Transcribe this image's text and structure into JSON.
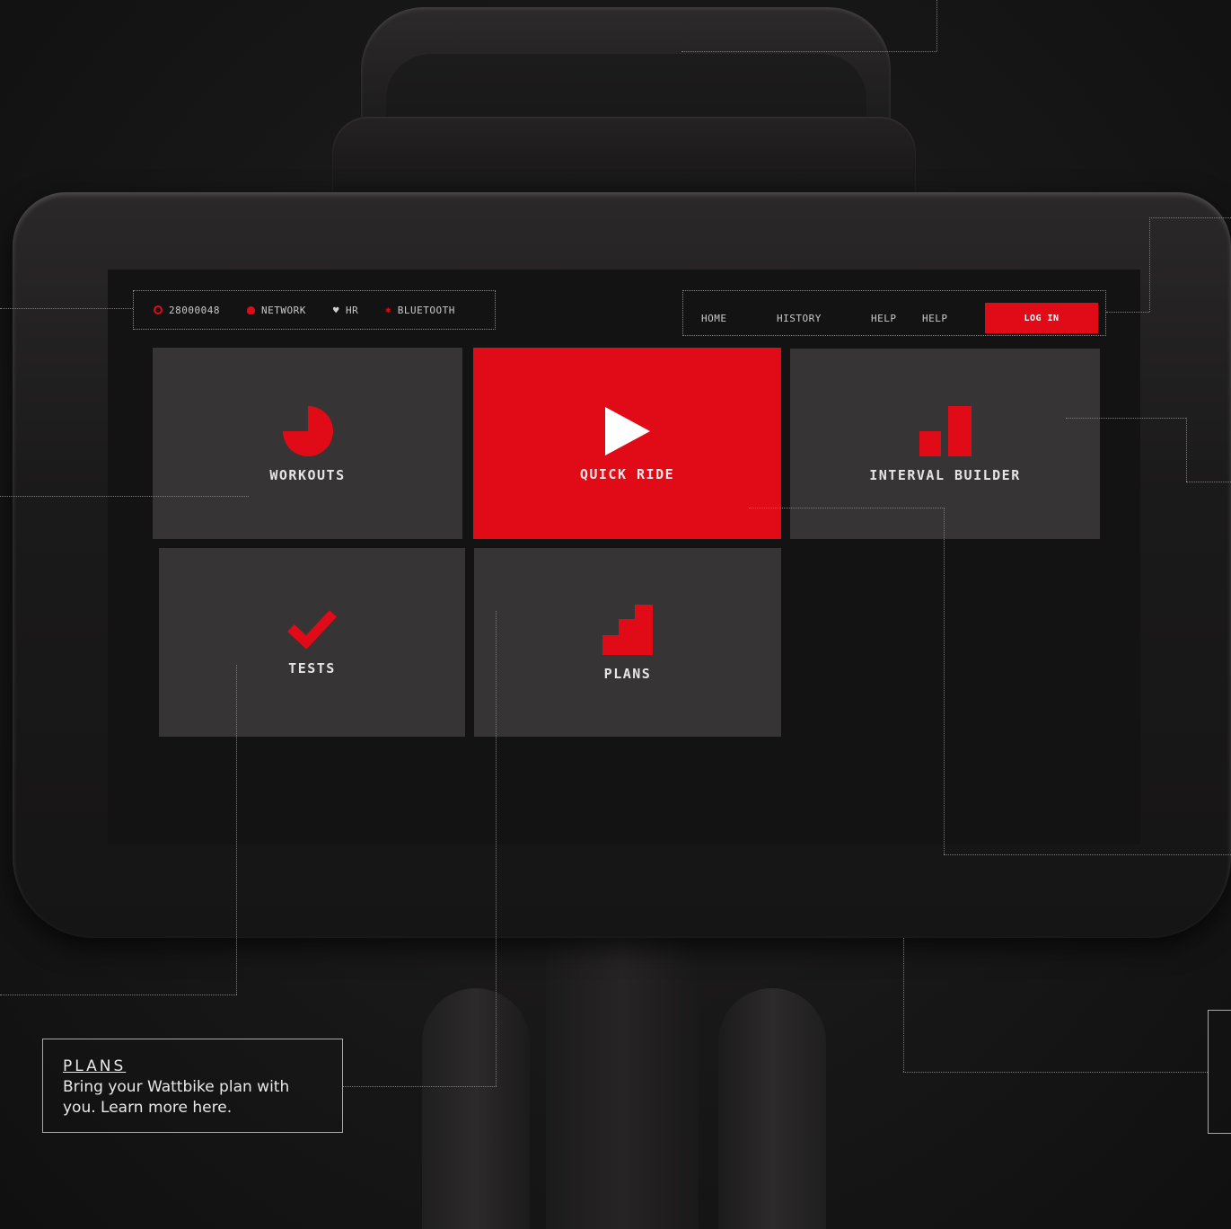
{
  "status_bar": {
    "items": [
      {
        "icon": "power-ring-icon",
        "label": "28000048"
      },
      {
        "icon": "cloud-icon",
        "label": "NETWORK"
      },
      {
        "icon": "heart-icon",
        "label": "HR"
      },
      {
        "icon": "bluetooth-icon",
        "label": "BLUETOOTH"
      }
    ]
  },
  "nav": {
    "items": [
      "HOME",
      "HISTORY",
      "HELP",
      "HELP"
    ],
    "login_label": "LOG IN"
  },
  "tiles": {
    "workouts": {
      "label": "WORKOUTS",
      "icon": "pie-chart-icon"
    },
    "quick_ride": {
      "label": "QUICK RIDE",
      "icon": "play-icon"
    },
    "interval_builder": {
      "label": "INTERVAL BUILDER",
      "icon": "bar-chart-icon"
    },
    "tests": {
      "label": "TESTS",
      "icon": "checkmark-icon"
    },
    "plans": {
      "label": "PLANS",
      "icon": "steps-icon"
    }
  },
  "callout": {
    "title": "PLANS",
    "body": "Bring your Wattbike plan with you. Learn more here."
  },
  "colors": {
    "accent": "#e10b17",
    "tile": "#363434",
    "background": "#121212"
  }
}
